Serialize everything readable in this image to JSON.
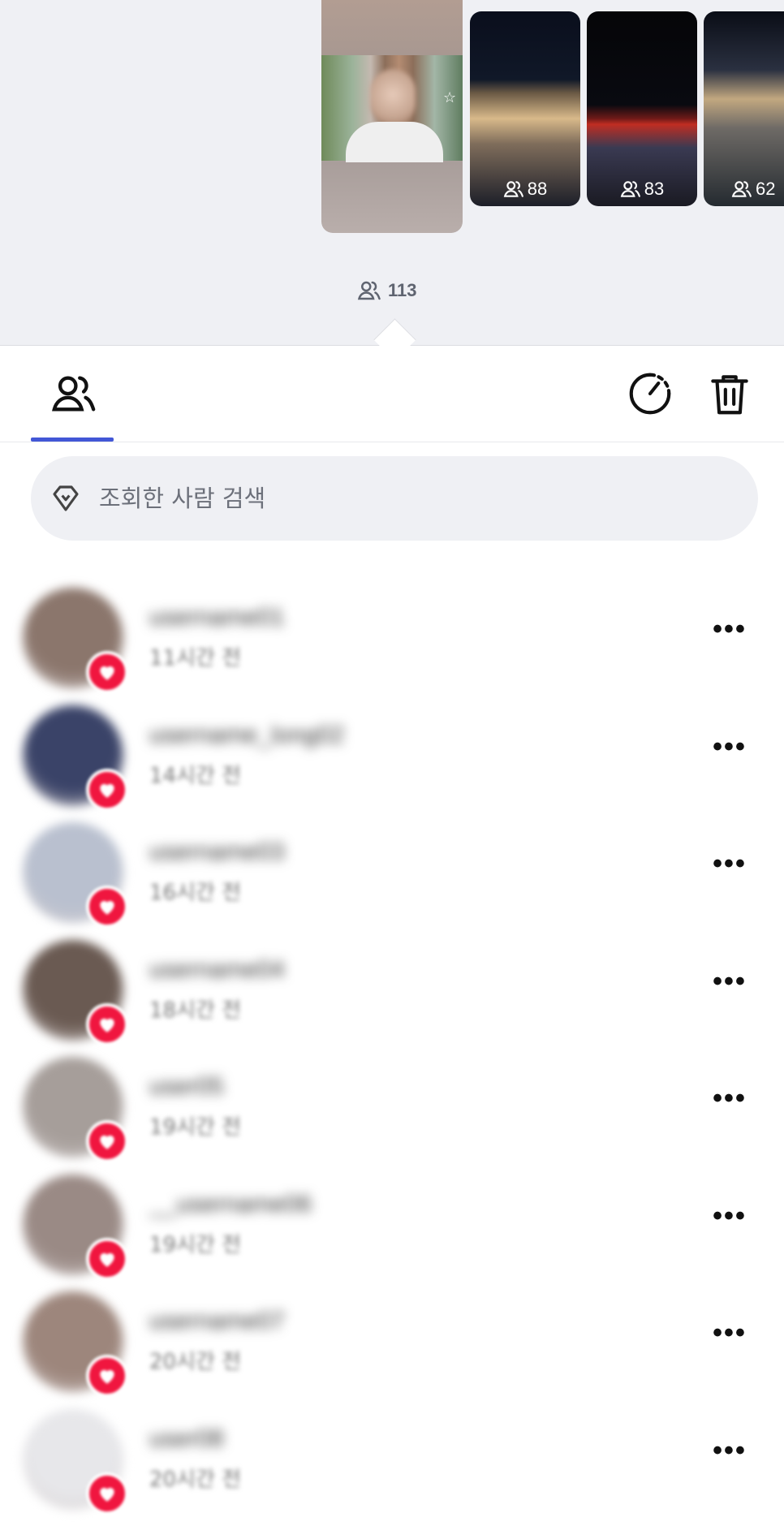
{
  "stories": {
    "thumbnails": [
      {
        "views": "88"
      },
      {
        "views": "83"
      },
      {
        "views": "62"
      }
    ],
    "selected_views": "113"
  },
  "tabs": {
    "viewers_icon": "viewers-icon",
    "timer_icon": "timer-icon",
    "delete_icon": "trash-icon",
    "accent_color": "#4257d6"
  },
  "search": {
    "placeholder": "조회한 사람 검색"
  },
  "viewers": [
    {
      "username": "username01",
      "time": "11시간 전",
      "avatar_color": "#8b766c",
      "reaction": "heart"
    },
    {
      "username": "username_long02",
      "time": "14시간 전",
      "avatar_color": "#3a4368",
      "reaction": "heart"
    },
    {
      "username": "username03",
      "time": "16시간 전",
      "avatar_color": "#b9c0cf",
      "reaction": "heart"
    },
    {
      "username": "username04",
      "time": "18시간 전",
      "avatar_color": "#6a5a52",
      "reaction": "heart"
    },
    {
      "username": "user05",
      "time": "19시간 전",
      "avatar_color": "#a69e9a",
      "reaction": "heart"
    },
    {
      "username": "__username06",
      "time": "19시간 전",
      "avatar_color": "#9a8a85",
      "reaction": "heart"
    },
    {
      "username": "username07",
      "time": "20시간 전",
      "avatar_color": "#9d867c",
      "reaction": "heart"
    },
    {
      "username": "user08",
      "time": "20시간 전",
      "avatar_color": "#e7e7ea",
      "reaction": "heart"
    }
  ],
  "more_label": "•••"
}
